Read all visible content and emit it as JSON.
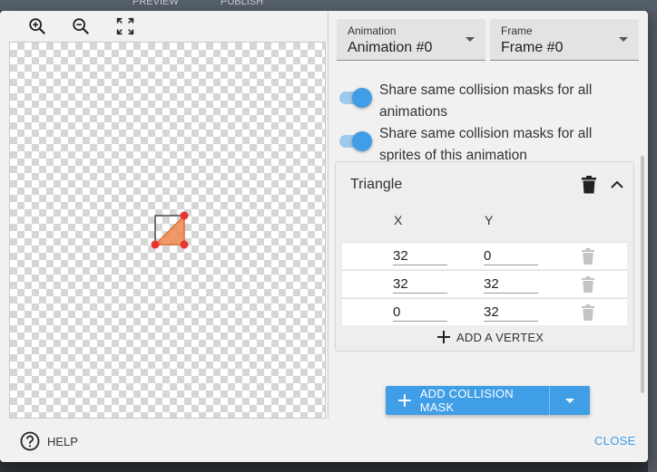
{
  "backdrop": {
    "preview_label": "PREVIEW",
    "publish_label": "PUBLISH"
  },
  "toolbar": {
    "zoom_in": "zoom-in-icon",
    "zoom_out": "zoom-out-icon",
    "fit": "fit-to-screen-icon"
  },
  "animation_select": {
    "label": "Animation",
    "value": "Animation #0"
  },
  "frame_select": {
    "label": "Frame",
    "value": "Frame #0"
  },
  "toggles": [
    {
      "label": "Share same collision masks for all animations",
      "on": true
    },
    {
      "label": "Share same collision masks for all sprites of this animation",
      "on": true
    }
  ],
  "shape": {
    "title": "Triangle",
    "col_x": "X",
    "col_y": "Y",
    "vertices": [
      {
        "x": "32",
        "y": "0"
      },
      {
        "x": "32",
        "y": "32"
      },
      {
        "x": "0",
        "y": "32"
      }
    ],
    "add_vertex_label": "ADD A VERTEX"
  },
  "add_mask_label": "ADD COLLISION MASK",
  "footer": {
    "help_label": "HELP",
    "close_label": "CLOSE"
  },
  "colors": {
    "accent": "#3f9ee6",
    "mask_fill": "#f08a50",
    "vertex": "#e8352f"
  }
}
